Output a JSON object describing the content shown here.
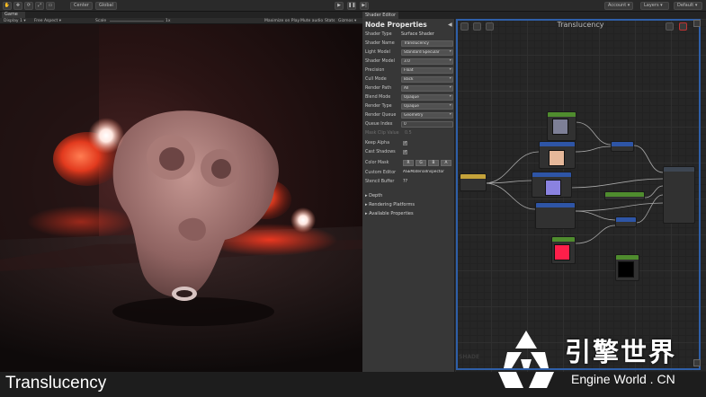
{
  "toolbar": {
    "pivot_label": "Center",
    "space_label": "Global",
    "account_label": "Account",
    "layers_label": "Layers",
    "layout_label": "Default"
  },
  "game_view": {
    "tab_label": "Game",
    "display_label": "Display 1",
    "aspect_label": "Free Aspect",
    "scale_label": "Scale",
    "scale_value": "1x",
    "maximize_label": "Maximize on Play",
    "mute_label": "Mute audio",
    "stats_label": "Stats",
    "gizmos_label": "Gizmos"
  },
  "shader_editor": {
    "tab_label": "Shader Editor",
    "panel_title": "Node Properties",
    "canvas_title": "Translucency",
    "watermark": "SHADE",
    "properties": [
      {
        "label": "Shader Type",
        "value": "Surface Shader",
        "kind": "text"
      },
      {
        "label": "Shader Name",
        "value": "Translucency",
        "kind": "field"
      },
      {
        "label": "Light Model",
        "value": "Standard Specular",
        "kind": "dropdown"
      },
      {
        "label": "Shader Model",
        "value": "3.0",
        "kind": "dropdown"
      },
      {
        "label": "Precision",
        "value": "Float",
        "kind": "dropdown"
      },
      {
        "label": "Cull Mode",
        "value": "Back",
        "kind": "dropdown"
      },
      {
        "label": "Render Path",
        "value": "All",
        "kind": "dropdown"
      },
      {
        "label": "Blend Mode",
        "value": "Opaque",
        "kind": "dropdown"
      },
      {
        "label": "Render Type",
        "value": "Opaque",
        "kind": "dropdown"
      },
      {
        "label": "Render Queue",
        "value": "Geometry",
        "kind": "dropdown"
      },
      {
        "label": "Queue Index",
        "value": "0",
        "kind": "field"
      },
      {
        "label": "Mask Clip Value",
        "value": "0.5",
        "kind": "disabled"
      }
    ],
    "keep_alpha_label": "Keep Alpha",
    "cast_shadows_label": "Cast Shadows",
    "check_mark": "✓",
    "color_mask_label": "Color Mask",
    "color_mask_channels": [
      "R",
      "G",
      "B",
      "A"
    ],
    "custom_editor_label": "Custom Editor",
    "custom_editor_value": "ASEMaterialInspector",
    "stencil_buffer_label": "Stencil Buffer",
    "stencil_buffer_value": "??",
    "sections": [
      "Depth",
      "Rendering Platforms",
      "Available Properties"
    ]
  },
  "bottom": {
    "caption": "Translucency",
    "brand_cn": "引擎世界",
    "brand_en": "Engine World . CN"
  },
  "colors": {
    "accent_blue": "#2f5fa8",
    "node_blue": "#2e55a6",
    "node_green": "#4f8c2e",
    "node_yellow": "#c4a23a",
    "swatch_peach": "#e6b89a",
    "swatch_lilac": "#8a82e0",
    "swatch_red": "#ff1f4a"
  }
}
